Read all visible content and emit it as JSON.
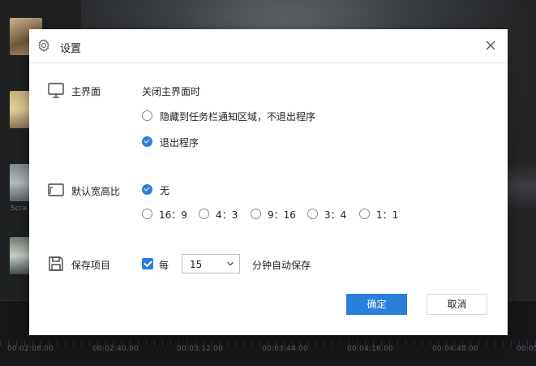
{
  "background": {
    "thumb_label": "Scra",
    "ruler_labels": [
      "00:02:08.00",
      "00:02:40.00",
      "00:03:12.00",
      "00:03:44.00",
      "00:04:16.00",
      "00:04:48.00",
      "00:05"
    ]
  },
  "dialog": {
    "title": "设置",
    "icons": {
      "title": "gear-icon",
      "close": "close-icon"
    },
    "main_ui": {
      "label": "主界面",
      "icon": "monitor-icon",
      "prompt": "关闭主界面时",
      "options": [
        {
          "label": "隐藏到任务栏通知区域，不退出程序",
          "selected": false
        },
        {
          "label": "退出程序",
          "selected": true
        }
      ]
    },
    "aspect_ratio": {
      "label": "默认宽高比",
      "icon": "aspect-ratio-icon",
      "none_label": "无",
      "none_selected": true,
      "ratios": [
        "16：9",
        "4：3",
        "9：16",
        "3：4",
        "1：1"
      ]
    },
    "autosave": {
      "label": "保存项目",
      "icon": "save-disk-icon",
      "checked": true,
      "every_label": "每",
      "interval_value": "15",
      "suffix": "分钟自动保存"
    },
    "buttons": {
      "ok": "确定",
      "cancel": "取消"
    },
    "colors": {
      "accent": "#2b7fdc"
    }
  }
}
